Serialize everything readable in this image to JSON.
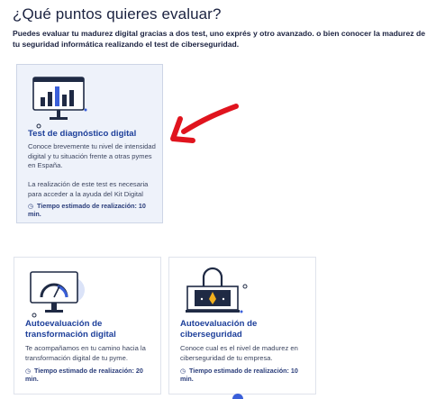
{
  "heading": "¿Qué puntos quieres evaluar?",
  "intro": "Puedes evaluar tu madurez digital gracias a dos test, uno exprés y otro avanzado. o bien conocer la madurez de tu seguridad informática realizando el test de ciberseguridad.",
  "cards": [
    {
      "title": "Test de diagnóstico digital",
      "description": "Conoce brevemente tu nivel de intensidad digital y tu situación frente a otras pymes en España.",
      "note": "La realización de este test es necesaria para acceder a la ayuda del Kit Digital",
      "time": "Tiempo estimado de realización: 10 min.",
      "illustration": "monitor-bar-chart-illustration",
      "selected": true
    },
    {
      "title": "Autoevaluación de transformación digital",
      "description": "Te acompañamos en tu camino hacia la transformación digital de tu pyme.",
      "time": "Tiempo estimado de realización: 20 min.",
      "illustration": "monitor-gauge-illustration",
      "selected": false
    },
    {
      "title": "Autoevaluación de ciberseguridad",
      "description": "Conoce cual es el nivel de madurez en ciberseguridad de tu empresa.",
      "time": "Tiempo estimado de realización: 10 min.",
      "illustration": "padlock-illustration",
      "selected": false
    }
  ],
  "annotation": {
    "shape": "red-hand-drawn-arrow",
    "color": "#e0141e"
  },
  "colors": {
    "accent": "#1d3f9a",
    "icon_blue": "#3a5fd9",
    "selected_bg": "#eef2fa"
  }
}
